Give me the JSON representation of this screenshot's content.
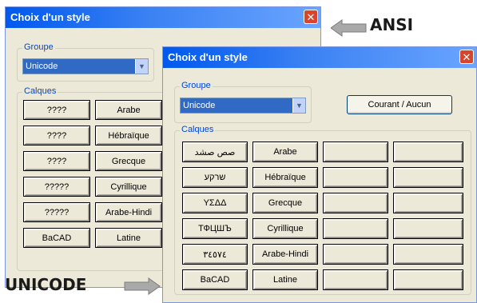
{
  "back_window": {
    "title": "Choix d'un style",
    "close_glyph": "✕",
    "groupe_label": "Groupe",
    "groupe_value": "Unicode",
    "calques_label": "Calques",
    "buttons": [
      [
        "????",
        "Arabe"
      ],
      [
        "????",
        "Hébraïque"
      ],
      [
        "????",
        "Grecque"
      ],
      [
        "?????",
        "Cyrillique"
      ],
      [
        "?????",
        "Arabe-Hindi"
      ],
      [
        "BaCAD",
        "Latine"
      ]
    ]
  },
  "front_window": {
    "title": "Choix d'un style",
    "close_glyph": "✕",
    "groupe_label": "Groupe",
    "groupe_value": "Unicode",
    "current_button": "Courant / Aucun",
    "calques_label": "Calques",
    "buttons": [
      [
        "صص صشد",
        "Arabe"
      ],
      [
        "שרקע",
        "Hébraïque"
      ],
      [
        "ΥΣΔΔ",
        "Grecque"
      ],
      [
        "ТФЦШЪ",
        "Cyrillique"
      ],
      [
        "٣٤٥٧٤",
        "Arabe-Hindi"
      ],
      [
        "BaCAD",
        "Latine"
      ]
    ]
  },
  "annotations": {
    "ansi": "ANSI",
    "unicode": "UNICODE"
  },
  "colors": {
    "titlebar": "#0058ee",
    "close": "#d8452a",
    "window_bg": "#ece9d8",
    "select_bg": "#316ac5",
    "arrow": "#a9a9a9"
  }
}
